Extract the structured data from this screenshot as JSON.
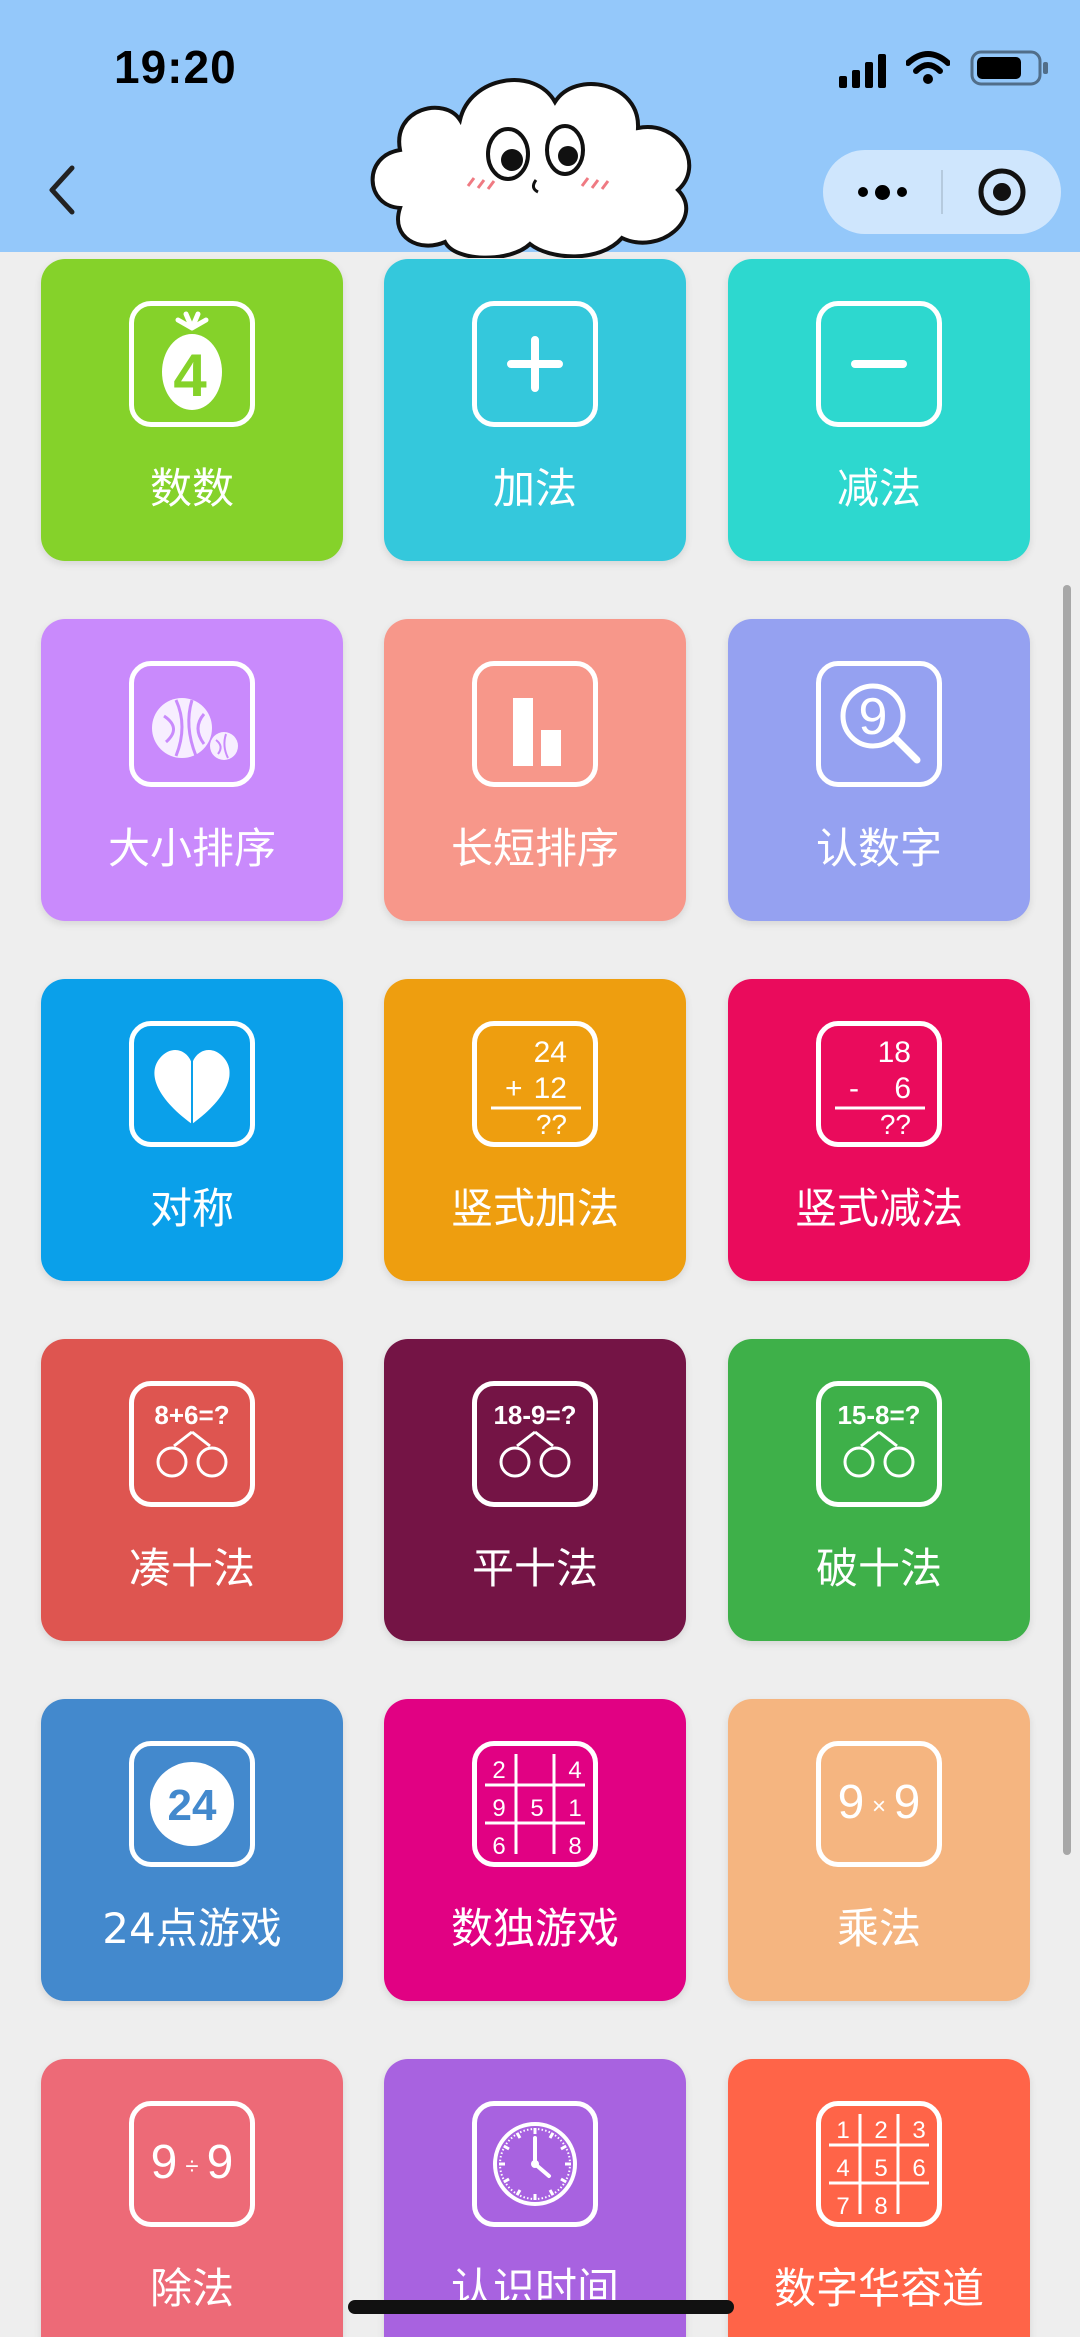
{
  "status_bar": {
    "time": "19:20"
  },
  "cards": [
    {
      "label": "数数",
      "color": "#85d22a",
      "icon": "pineapple-four-icon",
      "icon_text": [
        "4"
      ]
    },
    {
      "label": "加法",
      "color": "#34c8dc",
      "icon": "plus-icon"
    },
    {
      "label": "减法",
      "color": "#2dd8cf",
      "icon": "minus-icon"
    },
    {
      "label": "大小排序",
      "color": "#c98afc",
      "icon": "watermelons-icon"
    },
    {
      "label": "长短排序",
      "color": "#f7978a",
      "icon": "bar-chart-icon"
    },
    {
      "label": "认数字",
      "color": "#95a1f1",
      "icon": "magnifier-nine-icon",
      "icon_text": [
        "9"
      ]
    },
    {
      "label": "对称",
      "color": "#0aa0ea",
      "icon": "heart-symmetry-icon"
    },
    {
      "label": "竖式加法",
      "color": "#ee9e0f",
      "icon": "vertical-addition-icon",
      "icon_text": [
        "24",
        "+",
        "12",
        "??"
      ]
    },
    {
      "label": "竖式减法",
      "color": "#ea0b5c",
      "icon": "vertical-subtraction-icon",
      "icon_text": [
        "18",
        "-",
        "6",
        "??"
      ]
    },
    {
      "label": "凑十法",
      "color": "#de5550",
      "icon": "make-ten-icon",
      "icon_text": [
        "8+6=?"
      ]
    },
    {
      "label": "平十法",
      "color": "#741445",
      "icon": "level-ten-icon",
      "icon_text": [
        "18-9=?"
      ]
    },
    {
      "label": "破十法",
      "color": "#3eb049",
      "icon": "break-ten-icon",
      "icon_text": [
        "15-8=?"
      ]
    },
    {
      "label": "24点游戏",
      "color": "#4389cd",
      "icon": "twenty-four-icon",
      "icon_text": [
        "24"
      ]
    },
    {
      "label": "数独游戏",
      "color": "#e10183",
      "icon": "sudoku-icon",
      "icon_text": [
        "2",
        "4",
        "9",
        "5",
        "1",
        "6",
        "8"
      ]
    },
    {
      "label": "乘法",
      "color": "#f5b580",
      "icon": "multiply-icon",
      "icon_text": [
        "9",
        "×",
        "9"
      ]
    },
    {
      "label": "除法",
      "color": "#ed6a77",
      "icon": "divide-icon",
      "icon_text": [
        "9",
        "÷",
        "9"
      ]
    },
    {
      "label": "认识时间",
      "color": "#a862e0",
      "icon": "clock-icon"
    },
    {
      "label": "数字华容道",
      "color": "#ff6448",
      "icon": "number-slide-icon",
      "icon_text": [
        "1",
        "2",
        "3",
        "4",
        "5",
        "6",
        "7",
        "8"
      ]
    }
  ]
}
